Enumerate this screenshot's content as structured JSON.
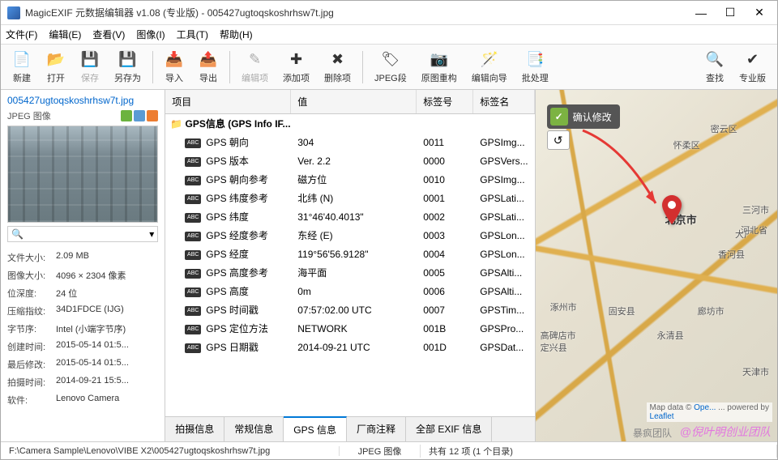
{
  "title": "MagicEXIF 元数据编辑器 v1.08 (专业版) - 005427ugtoqskoshrhsw7t.jpg",
  "menus": {
    "file": "文件(F)",
    "edit": "编辑(E)",
    "view": "查看(V)",
    "image": "图像(I)",
    "tools": "工具(T)",
    "help": "帮助(H)"
  },
  "toolbar": {
    "new": "新建",
    "open": "打开",
    "save": "保存",
    "save_as": "另存为",
    "import": "导入",
    "export": "导出",
    "edit_item": "编辑项",
    "add_item": "添加项",
    "del_item": "删除项",
    "jpeg_seg": "JPEG段",
    "rebuild": "原图重构",
    "wizard": "编辑向导",
    "batch": "批处理",
    "find": "查找",
    "pro": "专业版"
  },
  "left": {
    "filename": "005427ugtoqskoshrhsw7t.jpg",
    "filetype": "JPEG 图像",
    "search_placeholder": "",
    "meta": {
      "size_l": "文件大小:",
      "size_v": "2.09 MB",
      "dim_l": "图像大小:",
      "dim_v": "4096 × 2304 像素",
      "depth_l": "位深度:",
      "depth_v": "24 位",
      "comp_l": "压缩指纹:",
      "comp_v": "34D1FDCE (IJG)",
      "endian_l": "字节序:",
      "endian_v": "Intel (小端字节序)",
      "ctime_l": "创建时间:",
      "ctime_v": "2015-05-14 01:5...",
      "mtime_l": "最后修改:",
      "mtime_v": "2015-05-14 01:5...",
      "shot_l": "拍摄时间:",
      "shot_v": "2014-09-21 15:5...",
      "sw_l": "软件:",
      "sw_v": "Lenovo Camera"
    }
  },
  "grid": {
    "headers": {
      "item": "项目",
      "value": "值",
      "tagno": "标签号",
      "tagname": "标签名"
    },
    "folder": "GPS信息 (GPS Info IF...",
    "rows": [
      {
        "item": "GPS 朝向",
        "value": "304",
        "tagno": "0011",
        "tagname": "GPSImg..."
      },
      {
        "item": "GPS 版本",
        "value": "Ver. 2.2",
        "tagno": "0000",
        "tagname": "GPSVers..."
      },
      {
        "item": "GPS 朝向参考",
        "value": "磁方位",
        "tagno": "0010",
        "tagname": "GPSImg..."
      },
      {
        "item": "GPS 纬度参考",
        "value": "北纬 (N)",
        "tagno": "0001",
        "tagname": "GPSLati..."
      },
      {
        "item": "GPS 纬度",
        "value": "31°46'40.4013\"",
        "tagno": "0002",
        "tagname": "GPSLati..."
      },
      {
        "item": "GPS 经度参考",
        "value": "东经 (E)",
        "tagno": "0003",
        "tagname": "GPSLon..."
      },
      {
        "item": "GPS 经度",
        "value": "119°56'56.9128\"",
        "tagno": "0004",
        "tagname": "GPSLon..."
      },
      {
        "item": "GPS 高度参考",
        "value": "海平面",
        "tagno": "0005",
        "tagname": "GPSAlti..."
      },
      {
        "item": "GPS 高度",
        "value": "0m",
        "tagno": "0006",
        "tagname": "GPSAlti..."
      },
      {
        "item": "GPS 时间戳",
        "value": "07:57:02.00 UTC",
        "tagno": "0007",
        "tagname": "GPSTim..."
      },
      {
        "item": "GPS 定位方法",
        "value": "NETWORK",
        "tagno": "001B",
        "tagname": "GPSPro..."
      },
      {
        "item": "GPS 日期戳",
        "value": "2014-09-21 UTC",
        "tagno": "001D",
        "tagname": "GPSDat..."
      }
    ]
  },
  "tabs": {
    "shoot": "拍摄信息",
    "general": "常规信息",
    "gps": "GPS 信息",
    "maker": "厂商注释",
    "all": "全部 EXIF 信息"
  },
  "map": {
    "confirm": "确认修改",
    "labels": {
      "beijing": "北京市",
      "tianjin": "天津市",
      "hebei": "河北省",
      "langfang": "廊坊市",
      "baoding": "涿州市",
      "miyun": "密云区",
      "huairou": "怀柔区",
      "sanhe": "三河市",
      "yongqing": "永清县",
      "guan": "固安县",
      "gaobeidian": "高碑店市",
      "dingxing": "定兴县",
      "xianghe": "香河县",
      "dachang": "大厂"
    },
    "attrib_prefix": "Map data © ",
    "attrib_link1": "Ope...",
    "attrib_mid": " ... powered by ",
    "attrib_link2": "Leaflet",
    "watermark": "@倪叶明创业团队",
    "watermark2": "暴疯团队"
  },
  "status": {
    "path": "F:\\Camera Sample\\Lenovo\\VIBE X2\\005427ugtoqskoshrhsw7t.jpg",
    "type": "JPEG 图像",
    "count": "共有 12 项 (1 个目录)"
  }
}
